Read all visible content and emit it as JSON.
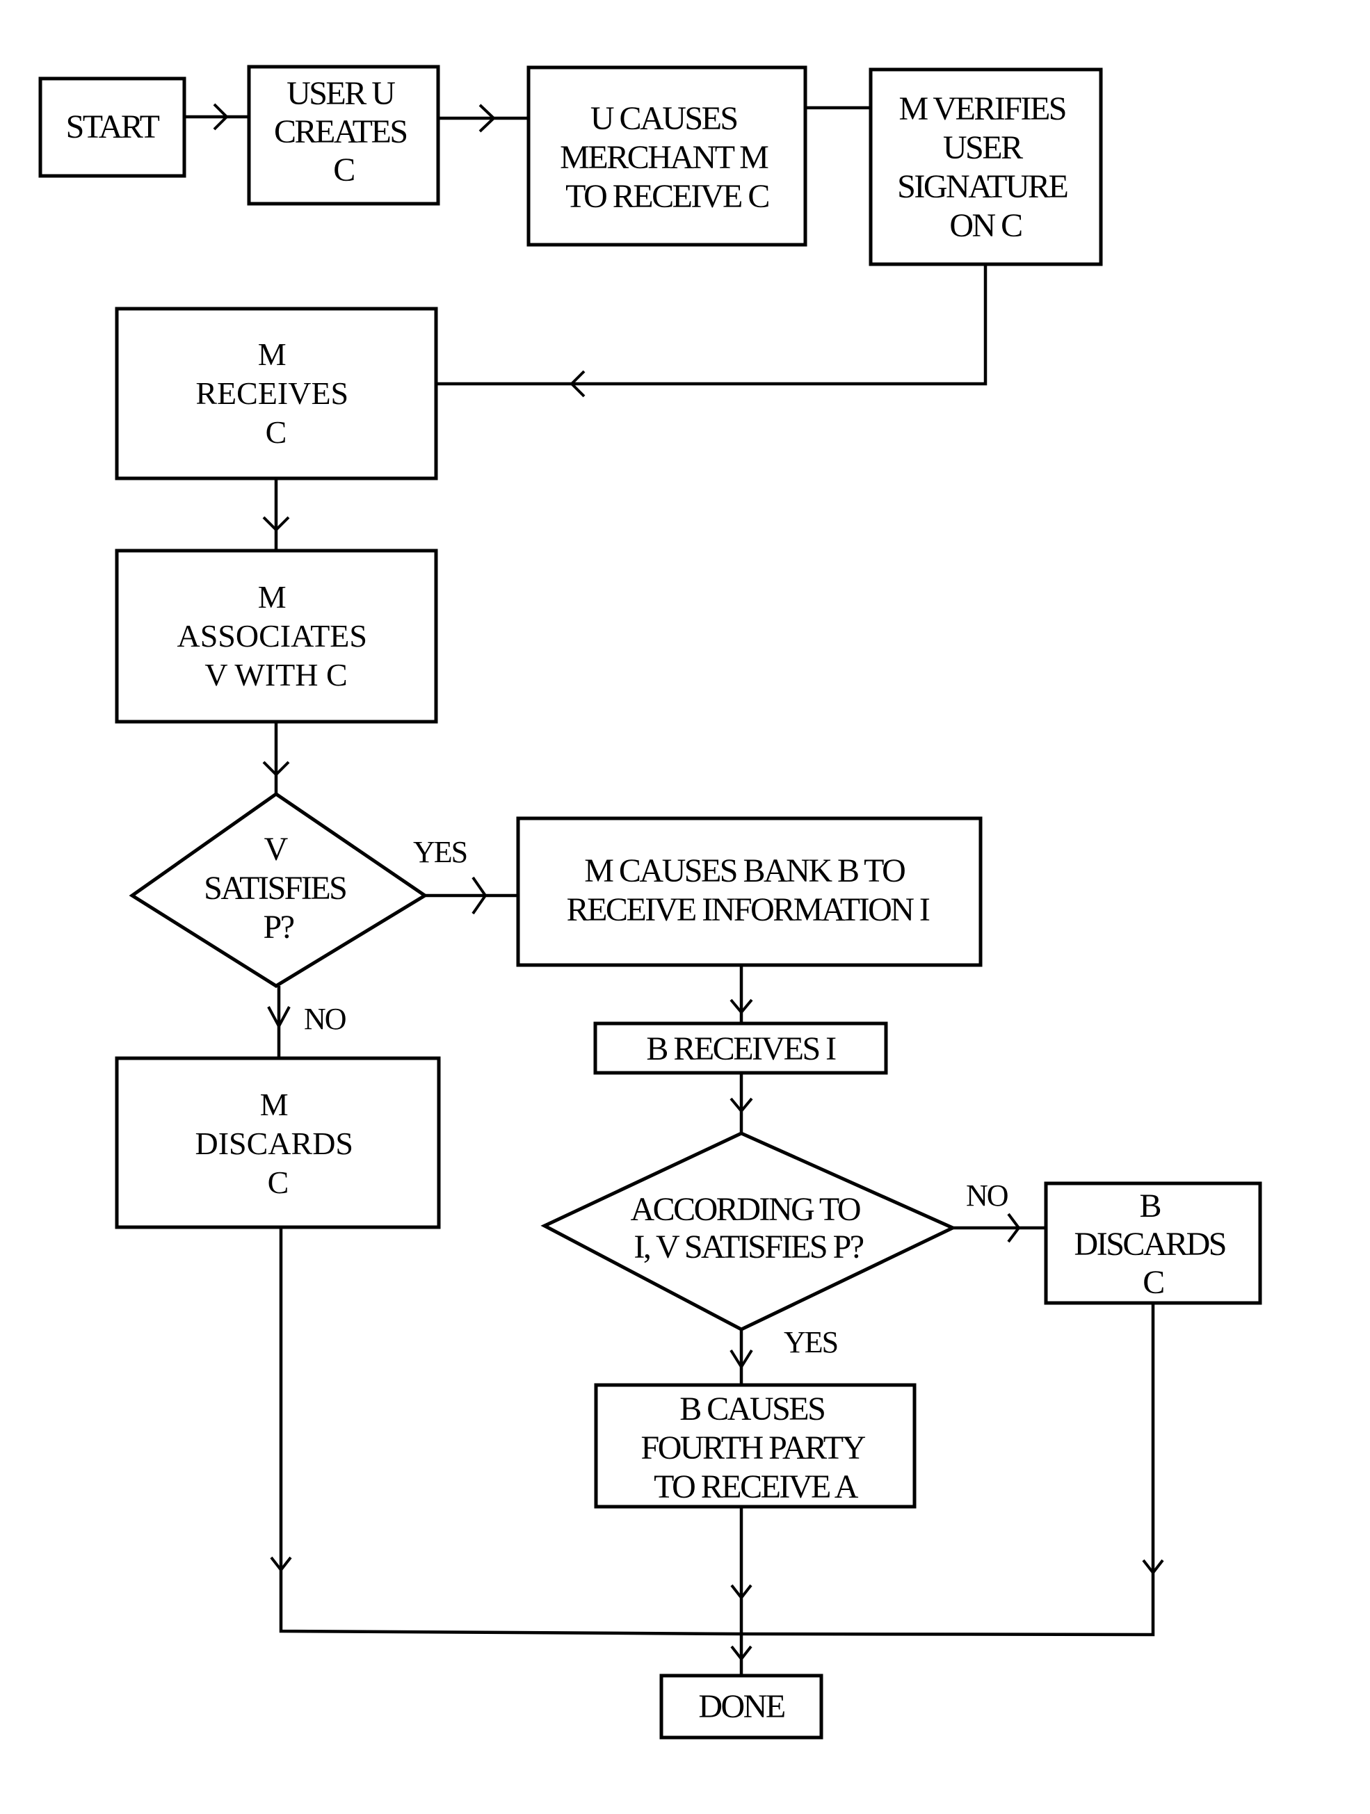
{
  "diagram": {
    "type": "flowchart",
    "nodes": {
      "start": {
        "shape": "process",
        "lines": [
          "START"
        ]
      },
      "user_creates": {
        "shape": "process",
        "lines": [
          "USER U",
          "CREATES",
          "C"
        ]
      },
      "u_causes_merchant": {
        "shape": "process",
        "lines": [
          "U CAUSES",
          "MERCHANT M",
          "TO RECEIVE C"
        ]
      },
      "m_verifies": {
        "shape": "process",
        "lines": [
          "M VERIFIES",
          "USER",
          "SIGNATURE",
          "ON C"
        ]
      },
      "m_receives": {
        "shape": "process",
        "lines": [
          "M",
          "RECEIVES",
          "C"
        ]
      },
      "m_associates": {
        "shape": "process",
        "lines": [
          "M",
          "ASSOCIATES",
          "V WITH C"
        ]
      },
      "v_satisfies": {
        "shape": "decision",
        "lines": [
          "V",
          "SATISFIES",
          "P?"
        ]
      },
      "m_causes_bank": {
        "shape": "process",
        "lines": [
          "M CAUSES BANK B TO",
          "RECEIVE INFORMATION I"
        ]
      },
      "b_receives": {
        "shape": "process",
        "lines": [
          "B RECEIVES I"
        ]
      },
      "according_to_i": {
        "shape": "decision",
        "lines": [
          "ACCORDING TO",
          "I, V SATISFIES P?"
        ]
      },
      "b_discards": {
        "shape": "process",
        "lines": [
          "B",
          "DISCARDS",
          "C"
        ]
      },
      "b_causes_fourth": {
        "shape": "process",
        "lines": [
          "B CAUSES",
          "FOURTH PARTY",
          "TO RECEIVE A"
        ]
      },
      "m_discards": {
        "shape": "process",
        "lines": [
          "M",
          "DISCARDS",
          "C"
        ]
      },
      "done": {
        "shape": "terminal",
        "lines": [
          "DONE"
        ]
      }
    },
    "edges": [
      {
        "from": "start",
        "to": "user_creates",
        "label": ""
      },
      {
        "from": "user_creates",
        "to": "u_causes_merchant",
        "label": ""
      },
      {
        "from": "u_causes_merchant",
        "to": "m_verifies",
        "label": ""
      },
      {
        "from": "m_verifies",
        "to": "m_receives",
        "label": ""
      },
      {
        "from": "m_receives",
        "to": "m_associates",
        "label": ""
      },
      {
        "from": "m_associates",
        "to": "v_satisfies",
        "label": ""
      },
      {
        "from": "v_satisfies",
        "to": "m_causes_bank",
        "label": "YES"
      },
      {
        "from": "v_satisfies",
        "to": "m_discards",
        "label": "NO"
      },
      {
        "from": "m_causes_bank",
        "to": "b_receives",
        "label": ""
      },
      {
        "from": "b_receives",
        "to": "according_to_i",
        "label": ""
      },
      {
        "from": "according_to_i",
        "to": "b_discards",
        "label": "NO"
      },
      {
        "from": "according_to_i",
        "to": "b_causes_fourth",
        "label": "YES"
      },
      {
        "from": "m_discards",
        "to": "done",
        "label": ""
      },
      {
        "from": "b_causes_fourth",
        "to": "done",
        "label": ""
      },
      {
        "from": "b_discards",
        "to": "done",
        "label": ""
      }
    ],
    "edge_labels": {
      "d1_yes": "YES",
      "d1_no": "NO",
      "d2_no": "NO",
      "d2_yes": "YES"
    }
  }
}
